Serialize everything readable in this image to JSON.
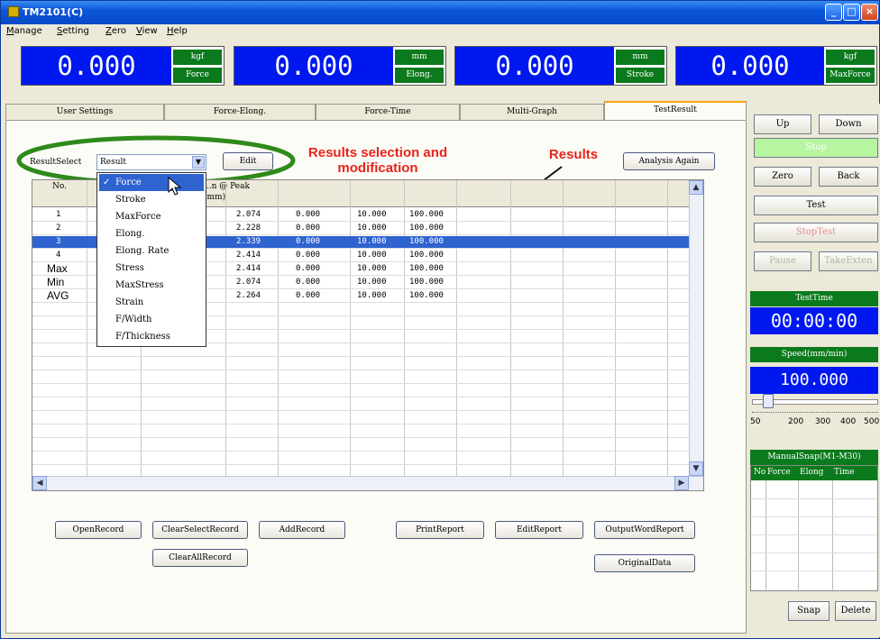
{
  "window": {
    "title": "TM2101(C)"
  },
  "menu": [
    "Manage",
    "Setting",
    "Zero",
    "View",
    "Help"
  ],
  "readouts": [
    {
      "value": "0.000",
      "unit": "kgf",
      "label": "Force"
    },
    {
      "value": "0.000",
      "unit": "mm",
      "label": "Elong."
    },
    {
      "value": "0.000",
      "unit": "mm",
      "label": "Stroke"
    },
    {
      "value": "0.000",
      "unit": "kgf",
      "label": "MaxForce"
    }
  ],
  "tabs": [
    "User Settings",
    "Force-Elong.",
    "Force-Time",
    "Multi-Graph",
    "TestResult"
  ],
  "result_select": {
    "label": "ResultSelect",
    "value": "Result",
    "edit": "Edit",
    "analysis_again": "Analysis Again"
  },
  "annotations": {
    "selection": "Results selection and modification",
    "results": "Results"
  },
  "dropdown": [
    "Force",
    "Stroke",
    "MaxForce",
    "Elong.",
    "Elong. Rate",
    "Stress",
    "MaxStress",
    "Strain",
    "F/Width",
    "F/Thickness"
  ],
  "grid": {
    "headers": {
      "no": "No.",
      "peak": "...n @ Peak",
      "peak_unit": "(mm)"
    },
    "rows": [
      {
        "no": "1",
        "peak": "2.074",
        "c3": "0.000",
        "c4": "10.000",
        "c5": "100.000"
      },
      {
        "no": "2",
        "peak": "2.228",
        "c3": "0.000",
        "c4": "10.000",
        "c5": "100.000"
      },
      {
        "no": "3",
        "peak": "2.339",
        "c3": "0.000",
        "c4": "10.000",
        "c5": "100.000"
      },
      {
        "no": "4",
        "peak": "2.414",
        "c3": "0.000",
        "c4": "10.000",
        "c5": "100.000"
      },
      {
        "no": "Max",
        "peak": "2.414",
        "c3": "0.000",
        "c4": "10.000",
        "c5": "100.000"
      },
      {
        "no": "Min",
        "peak": "2.074",
        "c3": "0.000",
        "c4": "10.000",
        "c5": "100.000"
      },
      {
        "no": "AVG",
        "peak": "2.264",
        "c3": "0.000",
        "c4": "10.000",
        "c5": "100.000"
      }
    ]
  },
  "bottom_buttons": {
    "open_record": "OpenRecord",
    "clear_select_record": "ClearSelectRecord",
    "add_record": "AddRecord",
    "clear_all_record": "ClearAllRecord",
    "print_report": "PrintReport",
    "edit_report": "EditReport",
    "output_word_report": "OutputWordReport",
    "original_data": "OriginalData"
  },
  "controls": {
    "up": "Up",
    "down": "Down",
    "stop": "Stop",
    "zero": "Zero",
    "back": "Back",
    "test": "Test",
    "stop_test": "StopTest",
    "pause": "Pause",
    "take_exten": "TakeExten",
    "test_time_label": "TestTime",
    "test_time": "00:00:00",
    "speed_label": "Speed(mm/min)",
    "speed": "100.000",
    "slider_ticks": [
      "50",
      "200",
      "300",
      "400",
      "500"
    ],
    "manual_snap_label": "ManualSnap(M1-M30)",
    "snap_cols": [
      "No",
      "Force",
      "Elong",
      "Time"
    ],
    "snap": "Snap",
    "delete": "Delete"
  }
}
